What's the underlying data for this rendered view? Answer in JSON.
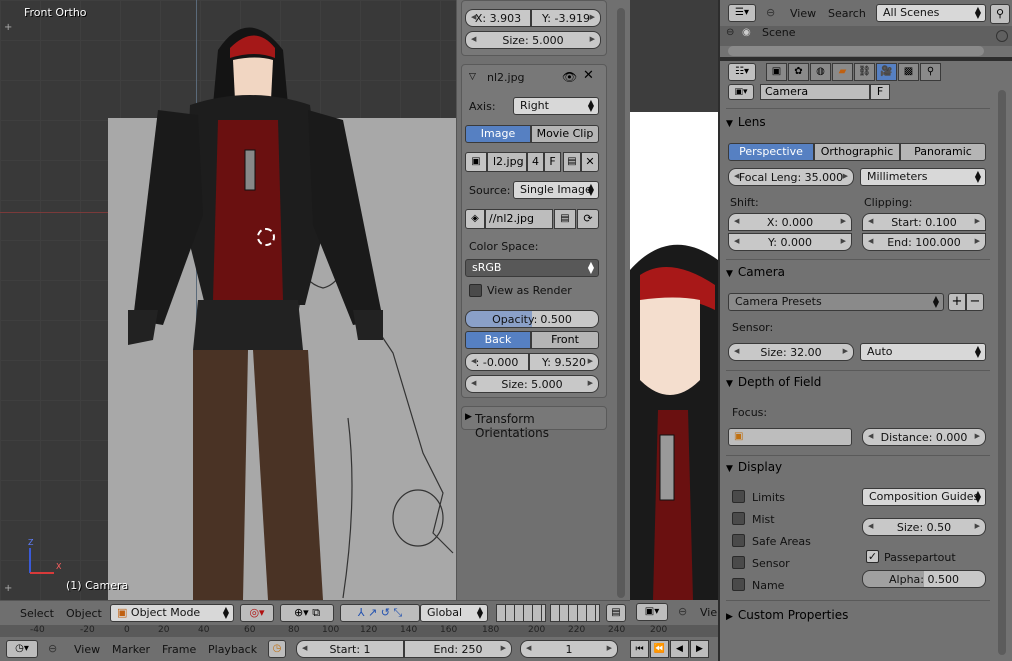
{
  "viewport": {
    "view_label": "Front Ortho",
    "object_label": "(1) Camera",
    "axis_z": "Z",
    "axis_x": "X"
  },
  "npanel": {
    "top_x": "X: 3.903",
    "top_y": "Y: -3.919",
    "top_size": "Size: 5.000",
    "image_name": "nl2.jpg",
    "axis_label": "Axis:",
    "axis_value": "Right",
    "tab_image": "Image",
    "tab_movie": "Movie Clip",
    "img_field": "l2.jpg",
    "img_users": "4",
    "img_fake": "F",
    "source_label": "Source:",
    "source_value": "Single Image",
    "filepath": "//nl2.jpg",
    "colorspace_label": "Color Space:",
    "colorspace_value": "sRGB",
    "view_as_render": "View as Render",
    "opacity": "Opacity:",
    "opacity_value": "0.500",
    "back": "Back",
    "front": "Front",
    "pos_x": ": -0.000",
    "pos_y": "Y: 9.520",
    "size": "Size: 5.000",
    "transform_orient": "Transform Orientations"
  },
  "outliner": {
    "view": "View",
    "search": "Search",
    "scenes": "All Scenes",
    "scene": "Scene"
  },
  "props": {
    "camera_name": "Camera",
    "fake": "F",
    "lens": {
      "title": "Lens",
      "tabs": [
        "Perspective",
        "Orthographic",
        "Panoramic"
      ],
      "focal": "Focal Leng: 35.000",
      "units": "Millimeters",
      "shift": "Shift:",
      "clipping": "Clipping:",
      "shift_x": "X: 0.000",
      "shift_y": "Y: 0.000",
      "clip_start": "Start: 0.100",
      "clip_end": "End: 100.000"
    },
    "camera": {
      "title": "Camera",
      "presets": "Camera Presets",
      "sensor": "Sensor:",
      "size": "Size: 32.00",
      "fit": "Auto"
    },
    "dof": {
      "title": "Depth of Field",
      "focus": "Focus:",
      "distance": "Distance: 0.000"
    },
    "display": {
      "title": "Display",
      "limits": "Limits",
      "mist": "Mist",
      "safe": "Safe Areas",
      "sensor": "Sensor",
      "name": "Name",
      "guides": "Composition Guides",
      "size": "Size: 0.50",
      "passepartout": "Passepartout",
      "alpha": "Alpha: 0.500"
    },
    "custom": "Custom Properties"
  },
  "header3d": {
    "select": "Select",
    "object": "Object",
    "mode": "Object Mode",
    "orientation": "Global"
  },
  "ruler": [
    "-40",
    "-20",
    "0",
    "20",
    "40",
    "60",
    "80",
    "100",
    "120",
    "140",
    "160",
    "180",
    "200",
    "220",
    "240"
  ],
  "camheader": {
    "view": "Vie",
    "ruler": "200"
  },
  "timeline": {
    "view": "View",
    "marker": "Marker",
    "frame": "Frame",
    "playback": "Playback",
    "start": "Start: 1",
    "end": "End: 250",
    "current": "1"
  }
}
